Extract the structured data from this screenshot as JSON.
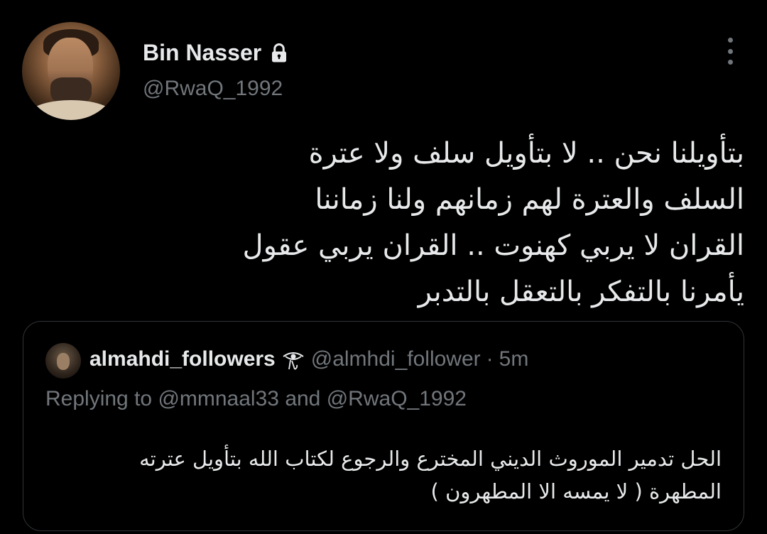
{
  "tweet": {
    "author": {
      "display_name": "Bin Nasser",
      "handle": "@RwaQ_1992",
      "protected_icon": "lock-icon"
    },
    "menu_icon": "more-vertical-icon",
    "text_lines": [
      "بتأويلنا نحن .. لا بتأويل سلف ولا عترة",
      "السلف والعترة لهم زمانهم ولنا زماننا",
      "القران لا يربي كهنوت .. القران يربي عقول",
      "يأمرنا بالتفكر بالتعقل بالتدبر"
    ]
  },
  "quoted_tweet": {
    "author": {
      "display_name": "almahdi_followers",
      "name_emoji_icon": "eye-emoji-icon",
      "handle": "@almhdi_follower",
      "separator": "·",
      "time": "5m"
    },
    "replying_to": {
      "prefix": "Replying to",
      "user1": "@mmnaal33",
      "conjunction": "and",
      "user2": "@RwaQ_1992"
    },
    "text_lines": [
      "الحل تدمير الموروث الديني المخترع والرجوع لكتاب الله بتأويل عترته",
      "المطهرة ( لا يمسه الا المطهرون )"
    ]
  },
  "colors": {
    "background": "#000000",
    "primary_text": "#e7e9ea",
    "secondary_text": "#71767b",
    "border": "#2f3336"
  }
}
